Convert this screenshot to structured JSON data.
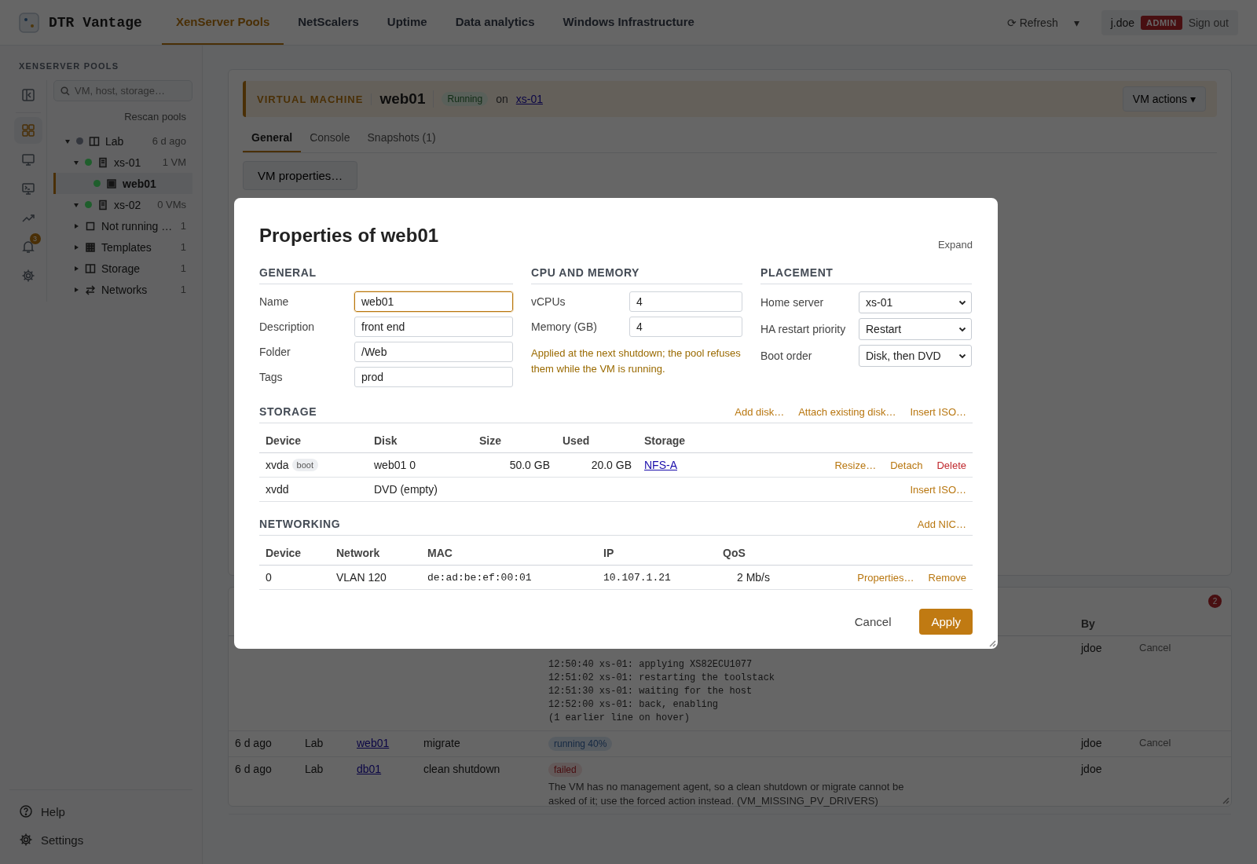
{
  "app": {
    "name": "DTR Vantage"
  },
  "nav": [
    {
      "label": "XenServer Pools",
      "selected": true
    },
    {
      "label": "NetScalers",
      "selected": false
    },
    {
      "label": "Uptime",
      "selected": false
    },
    {
      "label": "Data analytics",
      "selected": false
    },
    {
      "label": "Windows Infrastructure",
      "selected": false
    }
  ],
  "header": {
    "refresh": "⟳ Refresh",
    "menu_caret": "▾",
    "user": "j.doe",
    "role": "ADMIN",
    "sign_out": "Sign out"
  },
  "sidebar": {
    "title": "XENSERVER POOLS",
    "rail": [
      {
        "kind": "collapse",
        "selected": false
      },
      {
        "kind": "grid",
        "selected": true
      },
      {
        "kind": "monitor",
        "selected": false
      },
      {
        "kind": "console",
        "selected": false
      },
      {
        "kind": "trend",
        "selected": false
      },
      {
        "kind": "bell",
        "selected": false,
        "badge": "3"
      },
      {
        "kind": "gear",
        "selected": false
      }
    ],
    "search": {
      "placeholder": "VM, host, storage…"
    },
    "rescan": "Rescan pools",
    "tree": [
      {
        "label": "Lab",
        "kind": "pool",
        "color": "#33363d",
        "meta": "6 d ago",
        "expanded": true,
        "selected": false,
        "children": [
          {
            "label": "xs-01",
            "kind": "host",
            "color": "#1f5e2c",
            "meta": "1 VM",
            "expanded": true,
            "selected": false,
            "children": [
              {
                "label": "web01",
                "kind": "vm",
                "color": "#1f5e2c",
                "selected": true
              }
            ]
          },
          {
            "label": "xs-02",
            "kind": "host",
            "color": "#1f5e2c",
            "meta": "0 VMs",
            "expanded": true,
            "selected": false
          },
          {
            "label": "Not running …",
            "kind": "box",
            "meta": "1",
            "expanded": false,
            "selected": false
          },
          {
            "label": "Templates",
            "kind": "templates",
            "meta": "1",
            "expanded": false,
            "selected": false
          },
          {
            "label": "Storage",
            "kind": "pool",
            "meta": "1",
            "expanded": false,
            "selected": false
          },
          {
            "label": "Networks",
            "kind": "network",
            "meta": "1",
            "expanded": false,
            "selected": false
          }
        ]
      }
    ],
    "footer": [
      {
        "label": "Help",
        "kind": "help"
      },
      {
        "label": "Settings",
        "kind": "gear"
      }
    ]
  },
  "vm": {
    "kind_label": "VIRTUAL MACHINE",
    "name": "web01",
    "status": "Running",
    "on": "on",
    "host": "xs-01",
    "actions": "VM actions ▾",
    "tabs": [
      {
        "label": "General",
        "selected": true
      },
      {
        "label": "Console",
        "selected": false
      },
      {
        "label": "Snapshots (1)",
        "selected": false
      }
    ],
    "properties_button": "VM properties…"
  },
  "tasks": {
    "badge": "2",
    "columns": [
      {
        "label": "By"
      }
    ],
    "rows": [
      {
        "log": [
          "12:50:40 xs-01: applying XS82ECU1077",
          "12:51:02 xs-01: restarting the toolstack",
          "12:51:30 xs-01: waiting for the host",
          "12:52:00 xs-01: back, enabling",
          "(1 earlier line on hover)"
        ],
        "by": "jdoe",
        "cancel": "Cancel"
      },
      {
        "when": "6 d ago",
        "pool": "Lab",
        "object": "web01",
        "action": "migrate",
        "status": {
          "label": "running 40%",
          "kind": "running"
        },
        "by": "jdoe",
        "cancel": "Cancel"
      },
      {
        "when": "6 d ago",
        "pool": "Lab",
        "object": "db01",
        "action": "clean shutdown",
        "status": {
          "label": "failed",
          "kind": "failed"
        },
        "detail": "The VM has no management agent, so a clean shutdown or migrate cannot be asked of it; use the forced action instead. (VM_MISSING_PV_DRIVERS)",
        "by": "jdoe"
      }
    ]
  },
  "dialog": {
    "title": "Properties of web01",
    "expand": "Expand",
    "general": {
      "title": "GENERAL",
      "fields": [
        {
          "label": "Name",
          "value": "web01",
          "focused": true
        },
        {
          "label": "Description",
          "value": "front end",
          "focused": false
        },
        {
          "label": "Folder",
          "value": "/Web",
          "focused": false
        },
        {
          "label": "Tags",
          "value": "prod",
          "focused": false
        }
      ]
    },
    "cpu": {
      "title": "CPU AND MEMORY",
      "fields": [
        {
          "label": "vCPUs",
          "value": "4"
        },
        {
          "label": "Memory (GB)",
          "value": "4"
        }
      ],
      "note": "Applied at the next shutdown; the pool refuses them while the VM is running."
    },
    "placement": {
      "title": "PLACEMENT",
      "fields": [
        {
          "label": "Home server",
          "value": "xs-01"
        },
        {
          "label": "HA restart priority",
          "value": "Restart"
        },
        {
          "label": "Boot order",
          "value": "Disk, then DVD"
        }
      ]
    },
    "storage": {
      "title": "STORAGE",
      "actions": [
        "Add disk…",
        "Attach existing disk…",
        "Insert ISO…"
      ],
      "columns": [
        "Device",
        "Disk",
        "Size",
        "Used",
        "Storage"
      ],
      "rows": [
        {
          "device": "xvda",
          "tag": "boot",
          "disk": "web01 0",
          "size": "50.0 GB",
          "used": "20.0 GB",
          "storage": "NFS-A",
          "actions": [
            {
              "label": "Resize…",
              "kind": "normal"
            },
            {
              "label": "Detach",
              "kind": "normal"
            },
            {
              "label": "Delete",
              "kind": "danger"
            }
          ]
        },
        {
          "device": "xvdd",
          "disk": "DVD (empty)",
          "actions": [
            {
              "label": "Insert ISO…",
              "kind": "normal"
            }
          ]
        }
      ]
    },
    "networking": {
      "title": "NETWORKING",
      "actions": [
        "Add NIC…"
      ],
      "columns": [
        "Device",
        "Network",
        "MAC",
        "IP",
        "QoS"
      ],
      "rows": [
        {
          "device": "0",
          "network": "VLAN 120",
          "mac": "de:ad:be:ef:00:01",
          "ip": "10.107.1.21",
          "qos": "2 Mb/s",
          "actions": [
            {
              "label": "Properties…",
              "kind": "normal"
            },
            {
              "label": "Remove",
              "kind": "normal"
            }
          ]
        }
      ]
    },
    "buttons": {
      "cancel": "Cancel",
      "apply": "Apply"
    }
  }
}
